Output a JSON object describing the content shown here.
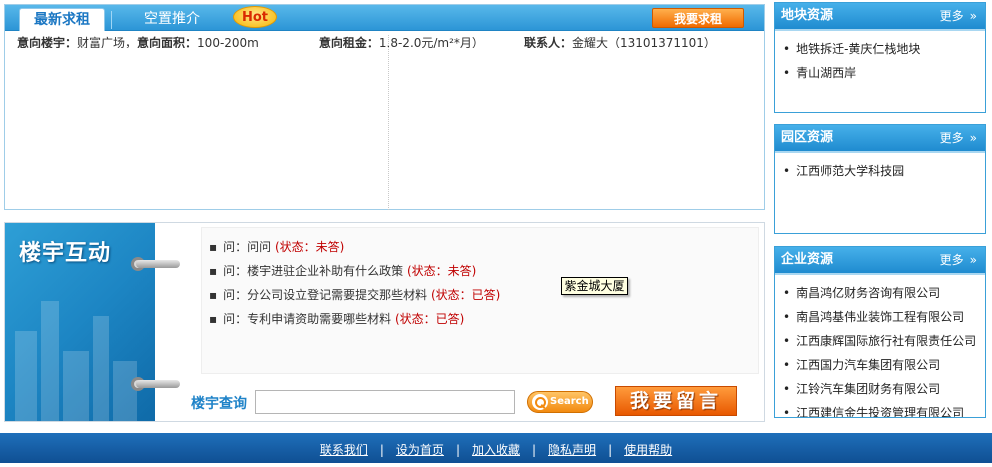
{
  "tabs": {
    "active_label": "最新求租",
    "other_label": "空置推介",
    "hot_badge": "Hot",
    "seek_button": "我要求租"
  },
  "listing_cut": {
    "l1": "意向楼宇：",
    "v1": "财富广场，",
    "l2": "意向面积：",
    "v2": "100-200m",
    "l3": "意向租金：",
    "v3": "1.8-2.0元/m²*月）",
    "l4": "联系人：",
    "v4": "金耀大（13101371101）"
  },
  "interaction": {
    "title": "楼宇互动",
    "questions": [
      {
        "prefix": "问：",
        "text": "问问",
        "status": "(状态：未答)"
      },
      {
        "prefix": "问：",
        "text": "楼宇进驻企业补助有什么政策",
        "status": "(状态：未答)"
      },
      {
        "prefix": "问：",
        "text": "分公司设立登记需要提交那些材料",
        "status": "(状态：已答)"
      },
      {
        "prefix": "问：",
        "text": "专利申请资助需要哪些材料",
        "status": "(状态：已答)"
      }
    ],
    "tooltip": "紫金城大厦",
    "query_label": "楼宇查询",
    "query_value": "",
    "search_button": "Search",
    "message_button": "我要留言"
  },
  "side": {
    "land": {
      "title": "地块资源",
      "more": "更多",
      "items": [
        "地铁拆迁-黄庆仁栈地块",
        "青山湖西岸"
      ]
    },
    "park": {
      "title": "园区资源",
      "more": "更多",
      "items": [
        "江西师范大学科技园"
      ]
    },
    "company": {
      "title": "企业资源",
      "more": "更多",
      "items": [
        "南昌鸿亿财务咨询有限公司",
        "南昌鸿基伟业装饰工程有限公司",
        "江西康辉国际旅行社有限责任公司",
        "江西国力汽车集团有限公司",
        "江铃汽车集团财务有限公司",
        "江西建信金牛投资管理有限公司"
      ]
    }
  },
  "footer": {
    "links": [
      "联系我们",
      "设为首页",
      "加入收藏",
      "隐私声明",
      "使用帮助"
    ],
    "separator": "|"
  },
  "colors": {
    "accent_blue": "#2c95d6",
    "orange": "#f06a00",
    "status_red": "#c00000",
    "footer_blue": "#0f4f93"
  }
}
